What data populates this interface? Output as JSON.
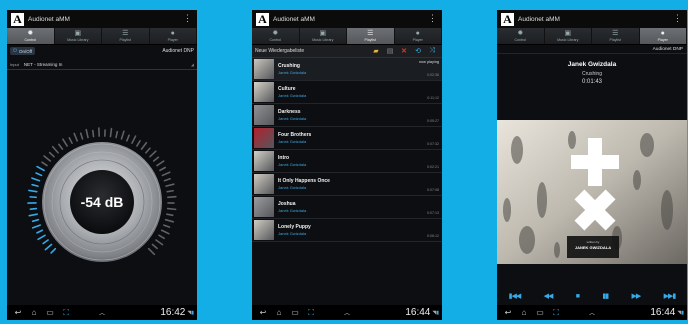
{
  "app": {
    "title": "Audionet aMM",
    "logo_letter": "A",
    "overflow_symbol": "⋮"
  },
  "tabs": [
    {
      "label": "Control",
      "icon": "gear-icon",
      "glyph": "✹"
    },
    {
      "label": "Music Library",
      "icon": "library-icon",
      "glyph": "▣"
    },
    {
      "label": "Playlist",
      "icon": "playlist-icon",
      "glyph": "☰"
    },
    {
      "label": "Player",
      "icon": "play-circle-icon",
      "glyph": "●"
    }
  ],
  "navbar": {
    "back": "↩",
    "home": "⌂",
    "recents": "▭",
    "screenshot": "⛶",
    "up": "︿",
    "clock": "16:42",
    "clock2": "16:44",
    "clock3": "16:44"
  },
  "control": {
    "power_label": "On/Off",
    "device": "Audionet DNP",
    "input_label": "Input",
    "input_value": "NET - Streaming In",
    "volume": "-54 dB",
    "volume_level": 0.28,
    "colors": {
      "accent": "#37a9e6",
      "tick_off": "#5f6266"
    }
  },
  "playlist": {
    "name": "Neue Wiedergabeliste",
    "now_playing_label": "now playing",
    "tracks": [
      {
        "title": "Crushing",
        "artist": "Janek Gwizdala",
        "duration": "0:02:36",
        "thumb": "#c9c6bd"
      },
      {
        "title": "Culture",
        "artist": "Janek Gwizdala",
        "duration": "0:11:12",
        "thumb": "#d6d2c8"
      },
      {
        "title": "Darkness",
        "artist": "Janek Gwizdala",
        "duration": "0:05:27",
        "thumb": "#8f9194"
      },
      {
        "title": "Four Brothers",
        "artist": "Janek Gwizdala",
        "duration": "0:07:32",
        "thumb": "#b3202e"
      },
      {
        "title": "Intro",
        "artist": "Janek Gwizdala",
        "duration": "0:02:21",
        "thumb": "#d3d0c8"
      },
      {
        "title": "It Only Happens Once",
        "artist": "Janek Gwizdala",
        "duration": "0:07:08",
        "thumb": "#cfcbc2"
      },
      {
        "title": "Joshua",
        "artist": "Janek Gwizdala",
        "duration": "0:07:13",
        "thumb": "#9a9ca0"
      },
      {
        "title": "Lonely Puppy",
        "artist": "Janek Gwizdala",
        "duration": "0:06:12",
        "thumb": "#d0ccc2"
      }
    ]
  },
  "player": {
    "device": "Audionet DNP",
    "artist": "Janek Gwizdala",
    "title": "Crushing",
    "time": "0:01:43",
    "album_caption": "written by",
    "album_artist": "JANEK GWIZDALA",
    "controls": [
      "▮◀◀",
      "◀◀",
      "■",
      "▮▮",
      "▶▶",
      "▶▶▮"
    ]
  }
}
